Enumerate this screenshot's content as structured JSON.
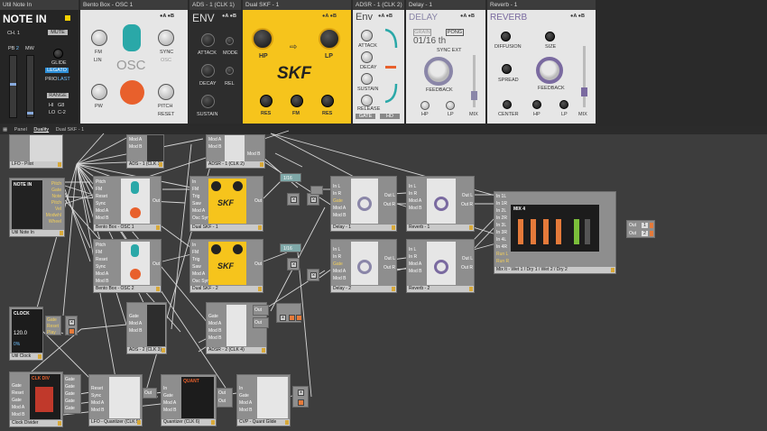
{
  "rack": {
    "devices": [
      {
        "title": "Util Note In",
        "heading": "NOTE IN",
        "ch": "CH. 1",
        "mute": "MUTE",
        "pb": "PB",
        "pb_val": "2",
        "mw": "MW",
        "glide": "GLIDE",
        "legato": "LEGATO",
        "prio": "PRIO",
        "last": "LAST",
        "range": "RANGE",
        "hi": "HI",
        "hi_val": "G8",
        "lo": "LO",
        "lo_val": "C-2"
      },
      {
        "title": "Bento Box - OSC 1",
        "heading": "OSC",
        "fm": "FM",
        "lin": "LIN",
        "sync": "SYNC",
        "osc": "OSC",
        "pw": "PW",
        "pitch": "PITCH",
        "reset": "RESET"
      },
      {
        "title": "ADS - 1 (CLK 1)",
        "heading": "ENV",
        "attack": "ATTACK",
        "mode": "MODE",
        "decay": "DECAY",
        "rel": "REL",
        "sustain": "SUSTAIN"
      },
      {
        "title": "Dual SKF - 1",
        "logo": "SKF",
        "hp": "HP",
        "lp": "LP",
        "res1": "RES",
        "fm": "FM",
        "res2": "RES"
      },
      {
        "title": "ADSR - 1 (CLK 2)",
        "heading": "Env",
        "attack": "ATTACK",
        "decay": "DECAY",
        "sustain": "SUSTAIN",
        "release": "RELEASE",
        "gate": "GATE",
        "hd": "HD"
      },
      {
        "title": "Delay - 1",
        "heading": "DELAY",
        "grain": "GRAIN",
        "pong": "PONG",
        "time": "01/16 th",
        "sync": "SYNC EXT",
        "feedback": "FEEDBACK",
        "hp": "HP",
        "lp": "LP",
        "mix": "MIX"
      },
      {
        "title": "Reverb - 1",
        "heading": "REVERB",
        "diffusion": "DIFFUSION",
        "size": "SIZE",
        "spread": "SPREAD",
        "feedback": "FEEDBACK",
        "center": "CENTER",
        "hp": "HP",
        "lp": "LP",
        "mix": "MIX"
      }
    ],
    "ab_a": "A",
    "ab_b": "B"
  },
  "breadcrumb": [
    "Panel",
    "Duality",
    "Dual SKF - 1"
  ],
  "modules": {
    "lfo_pilot": "LFO - Pilot",
    "ads_clk1": "ADS - 1 (CLK 1)",
    "adsr_clk2": "ADSR - 1 (CLK 2)",
    "note_in": "Util Note In",
    "bento1": "Bento Box - OSC 1",
    "skf1": "Dual SKF - 1",
    "delay1": "Delay - 1",
    "reverb1": "Reverb - 1",
    "mixer": "Mix It - Wet 1 / Dry 1 / Wet 2 / Dry 2",
    "bento2": "Bento Box - OSC 2",
    "skf2": "Dual SKF - 2",
    "delay2": "Delay - 2",
    "reverb2": "Reverb - 2",
    "clock": "Util Clock",
    "ads_clk3": "ADS - 2 (CLK 3)",
    "adsr_clk4": "ADSR - 2 (CLK 4)",
    "divider": "Clock Divider",
    "lfo_quant": "LFO - Quantizer (CLK 5)",
    "quant": "Quantizer (CLK 6)",
    "cvp": "CVP - Quant Glide"
  },
  "ports": {
    "note_out": [
      "Pitch",
      "Gate",
      "Note",
      "Pitch",
      "Vel",
      "Modwhl",
      "Wheel"
    ],
    "osc_in": [
      "Pitch",
      "FM",
      "Reset",
      "Sync",
      "Mod A",
      "Mod B"
    ],
    "osc_out": "Out",
    "skf_in": [
      "In",
      "FM",
      "Trig",
      "Saw",
      "Mod A",
      "Osc Sync"
    ],
    "skf_out": "Out",
    "delay_in": [
      "In L",
      "In R",
      "Gate",
      "Mod A",
      "Mod B"
    ],
    "delay_out": [
      "Out L",
      "Out R"
    ],
    "reverb_in": [
      "In L",
      "In R",
      "Mod A",
      "Mod B"
    ],
    "reverb_out": [
      "Out L",
      "Out R"
    ],
    "mixer_in": [
      "In 1L",
      "In 1R",
      "In 2L",
      "In 2R",
      "In 3L",
      "In 3R",
      "In 4L",
      "In 4R",
      "Run L",
      "Run R"
    ],
    "mixer_out": [
      "Out L",
      "Out R"
    ],
    "env_in": [
      "Gate",
      "Mod A",
      "Mod B"
    ],
    "env_in4": [
      "Gate",
      "Mod A",
      "Mod B",
      "Mod B"
    ],
    "clock_out": [
      "Gate",
      "Reset",
      "Play"
    ],
    "divider_in": [
      "Gate",
      "Reset",
      "Gate",
      "Mod A",
      "Mod B"
    ],
    "divider_out": [
      "Gate",
      "Gate",
      "Gate",
      "Gate",
      "Gate"
    ],
    "lfo_q_in": [
      "Reset",
      "Sync",
      "Mod A",
      "Mod B"
    ],
    "quant_in": [
      "In",
      "Gate",
      "Mod A",
      "Mod B"
    ],
    "cvp_in": [
      "In",
      "Gate",
      "Mod A",
      "Mod B"
    ],
    "out_labels": [
      "Out",
      "Out"
    ]
  },
  "clock": {
    "heading": "CLOCK",
    "bpm": "120.0",
    "pct": "0%"
  },
  "divider": {
    "heading": "CLK DIV"
  },
  "quantizer": {
    "heading": "QUANT"
  },
  "mixer_face": {
    "heading": "MIX 4"
  },
  "small_value": "1/16",
  "output_labels": [
    "Out",
    "Out"
  ],
  "output_values": [
    "1",
    "2"
  ],
  "colors": {
    "skf_yellow": "#f6c41c",
    "osc_teal": "#2aa8a8",
    "osc_orange": "#e8602c",
    "delay_purple": "#8a86a8",
    "reverb_purple": "#7a6aa0",
    "gain_orange": "#e57a3a"
  }
}
